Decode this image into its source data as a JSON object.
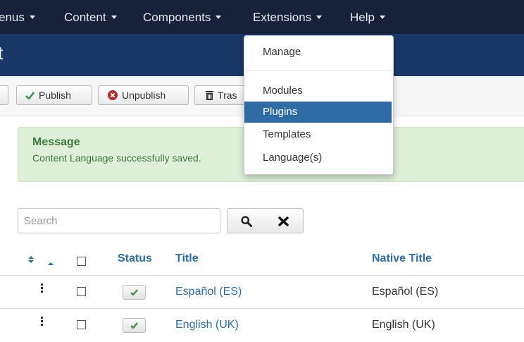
{
  "navbar": {
    "items": [
      {
        "label": "enus"
      },
      {
        "label": "Content"
      },
      {
        "label": "Components"
      },
      {
        "label": "Extensions"
      },
      {
        "label": "Help"
      }
    ]
  },
  "header": {
    "title": "t"
  },
  "toolbar": {
    "publish_label": "Publish",
    "unpublish_label": "Unpublish",
    "trash_label": "Tras"
  },
  "message": {
    "heading": "Message",
    "text": "Content Language successfully saved."
  },
  "search": {
    "placeholder": "Search",
    "value": ""
  },
  "table": {
    "headers": {
      "status": "Status",
      "title": "Title",
      "native_title": "Native Title"
    },
    "rows": [
      {
        "title": "Español (ES)",
        "native_title": "Español (ES)",
        "status": "published"
      },
      {
        "title": "English (UK)",
        "native_title": "English (UK)",
        "status": "published"
      }
    ]
  },
  "extensions_menu": {
    "items": [
      {
        "label": "Manage"
      },
      {
        "label": "Modules"
      },
      {
        "label": "Plugins",
        "active": true
      },
      {
        "label": "Templates"
      },
      {
        "label": "Language(s)"
      }
    ]
  },
  "colors": {
    "navbar": "#17213a",
    "subheader": "#1a3867",
    "link": "#2d6da3",
    "alert_bg": "#dff0d8",
    "menu_active": "#2f6ca6"
  },
  "icons": [
    "check-icon",
    "unpublish-icon",
    "trash-icon",
    "search-icon",
    "clear-icon",
    "sort-icon",
    "caret-up-icon",
    "drag-handle-icon"
  ]
}
